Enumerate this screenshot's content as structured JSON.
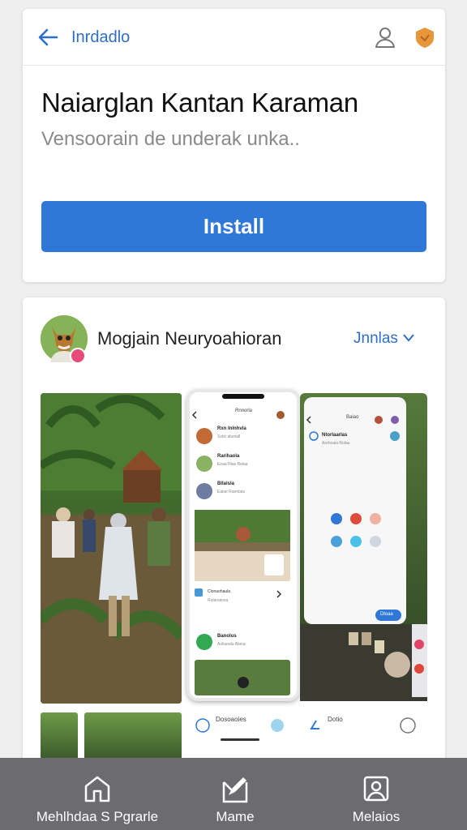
{
  "header": {
    "title": "Inrdadlo",
    "back_icon": "arrow-left-icon",
    "profile_icon": "person-icon",
    "shield_icon": "shield-icon"
  },
  "app": {
    "title": "Naiarglan Kantan Karaman",
    "subtitle": "Vensoorain de underak unka..",
    "install_label": "Install"
  },
  "developer": {
    "name": "Mogjain Neuryoahioran",
    "link_label": "Jnnlas"
  },
  "screenshots": {
    "phone_a": {
      "header": "Rnnorla",
      "rows": [
        {
          "title": "Rxn Inlnhvla",
          "subtitle": "Sslsr aluoiall"
        },
        {
          "title": "Rarihaola",
          "subtitle": "Enaa Rlae Belaa"
        },
        {
          "title": "Bllalsla",
          "subtitle": "Ealae Raenlaia"
        }
      ],
      "mid_title": "Clonaohaula",
      "mid_sub": "Rolanaiona",
      "green_title": "Banolus",
      "green_sub": "Aoliaoalu Alana"
    },
    "phone_b": {
      "header": "Baiao",
      "title": "Ntorlaarlas",
      "sub": "Aorhoaia Rolau",
      "cta": "Dloaa"
    }
  },
  "thumbs": {
    "label_a": "Dosoaoies",
    "label_b": "Dotio"
  },
  "bottom_nav": {
    "items": [
      {
        "label": "Mehlhdaa S Pgrarle",
        "icon": "home-icon"
      },
      {
        "label": "Mame",
        "icon": "edit-icon"
      },
      {
        "label": "Melaios",
        "icon": "account-icon"
      }
    ]
  },
  "colors": {
    "accent": "#2f78d8",
    "link": "#2f6fc9",
    "nav_bg": "#6b6b70",
    "shield": "#e8963a"
  }
}
